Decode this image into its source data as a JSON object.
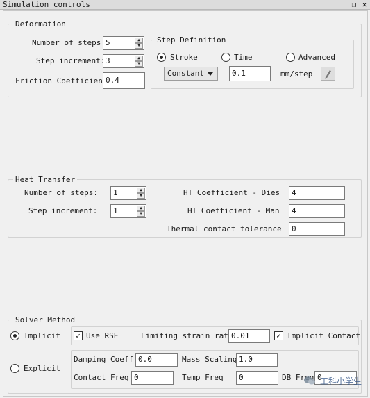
{
  "window": {
    "title": "Simulation controls",
    "restore_icon": "restore-icon",
    "close_icon": "close-icon"
  },
  "deformation": {
    "group_title": "Deformation",
    "steps_label": "Number of steps:",
    "steps_value": "5",
    "increment_label": "Step increment:",
    "increment_value": "3",
    "friction_label": "Friction Coefficient",
    "friction_value": "0.4"
  },
  "step_definition": {
    "group_title": "Step Definition",
    "options": [
      "Stroke",
      "Time",
      "Advanced"
    ],
    "selected": "Stroke",
    "mode_value": "Constant",
    "amount_value": "0.1",
    "unit": "mm/step",
    "edit_icon": "pencil-icon"
  },
  "heat_transfer": {
    "group_title": "Heat Transfer",
    "steps_label": "Number of steps:",
    "steps_value": "1",
    "increment_label": "Step increment:",
    "increment_value": "1",
    "ht_dies_label": "HT Coefficient - Dies",
    "ht_dies_value": "4",
    "ht_man_label": "HT Coefficient - Man",
    "ht_man_value": "4",
    "tolerance_label": "Thermal contact tolerance",
    "tolerance_value": "0"
  },
  "solver": {
    "group_title": "Solver Method",
    "implicit_label": "Implicit",
    "explicit_label": "Explicit",
    "selected": "Implicit",
    "use_rse_label": "Use RSE",
    "use_rse_checked": true,
    "limiting_label": "Limiting strain rate",
    "limiting_value": "0.01",
    "implicit_contact_label": "Implicit Contact",
    "implicit_contact_checked": true,
    "damping_label": "Damping Coeff",
    "damping_value": "0.0",
    "mass_label": "Mass Scaling",
    "mass_value": "1.0",
    "contact_freq_label": "Contact Freq",
    "contact_freq_value": "0",
    "temp_freq_label": "Temp Freq",
    "temp_freq_value": "0",
    "db_freq_label": "DB Freq",
    "db_freq_value": "0"
  },
  "watermark": "工科小学生"
}
